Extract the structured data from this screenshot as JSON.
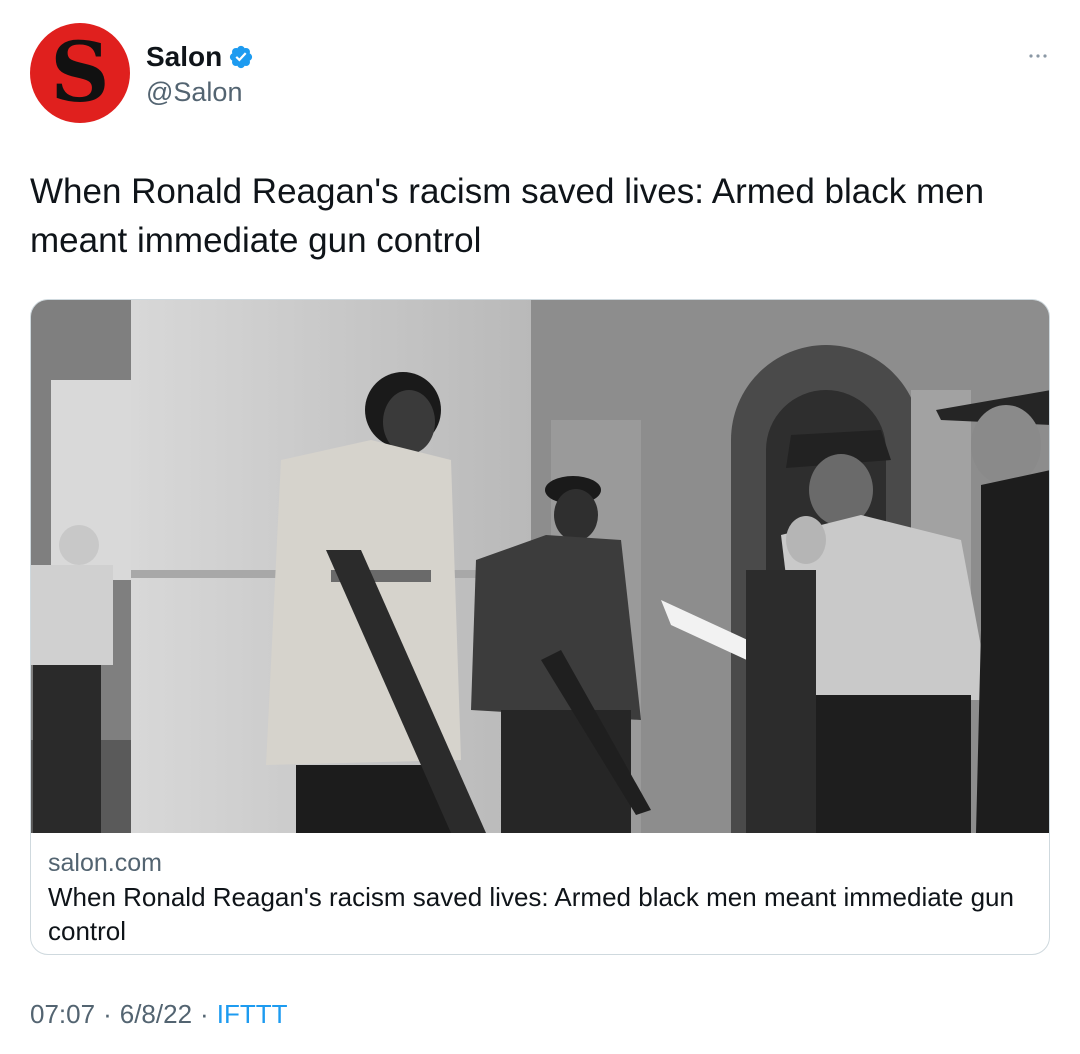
{
  "author": {
    "display_name": "Salon",
    "handle": "@Salon",
    "avatar_letter": "S",
    "avatar_color": "#e0201e",
    "verified": true,
    "verified_icon": "verified-badge-icon"
  },
  "tweet": {
    "text": "When Ronald Reagan's racism saved lives: Armed black men\nmeant immediate gun control"
  },
  "card": {
    "domain": "salon.com",
    "title": "When Ronald Reagan's racism saved lives: Armed black men meant immediate gun control",
    "photo": "black-and-white-photo-armed-men-and-police-officers"
  },
  "meta": {
    "time": "07:07",
    "date": "6/8/22",
    "separator": "·",
    "source": "IFTTT"
  },
  "colors": {
    "accent": "#1d9bf0",
    "secondary_text": "#536471",
    "border": "#cfd9de"
  }
}
